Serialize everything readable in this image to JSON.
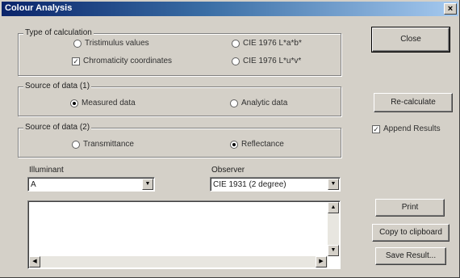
{
  "window": {
    "title": "Colour Analysis",
    "close_glyph": "×"
  },
  "calc_group": {
    "label": "Type of calculation",
    "options": [
      {
        "label": "Tristimulus values",
        "selected": false
      },
      {
        "label": "Chromaticity coordinates",
        "checked": true
      },
      {
        "label": "CIE 1976 L*a*b*",
        "selected": false
      },
      {
        "label": "CIE 1976 L*u*v*",
        "selected": false
      }
    ]
  },
  "source1_group": {
    "label": "Source of data (1)",
    "options": [
      {
        "label": "Measured data",
        "selected": true
      },
      {
        "label": "Analytic data",
        "selected": false
      }
    ]
  },
  "source2_group": {
    "label": "Source of data (2)",
    "options": [
      {
        "label": "Transmittance",
        "selected": false
      },
      {
        "label": "Reflectance",
        "selected": true
      }
    ]
  },
  "illuminant": {
    "label": "Illuminant",
    "value": "A"
  },
  "observer": {
    "label": "Observer",
    "value": "CIE 1931 (2 degree)"
  },
  "buttons": {
    "close": "Close",
    "recalculate": "Re-calculate",
    "append_results": "Append Results",
    "print": "Print",
    "copy": "Copy to clipboard",
    "save": "Save Result..."
  },
  "icons": {
    "down": "▼",
    "up": "▲",
    "left": "◀",
    "right": "▶",
    "check": "✓"
  }
}
